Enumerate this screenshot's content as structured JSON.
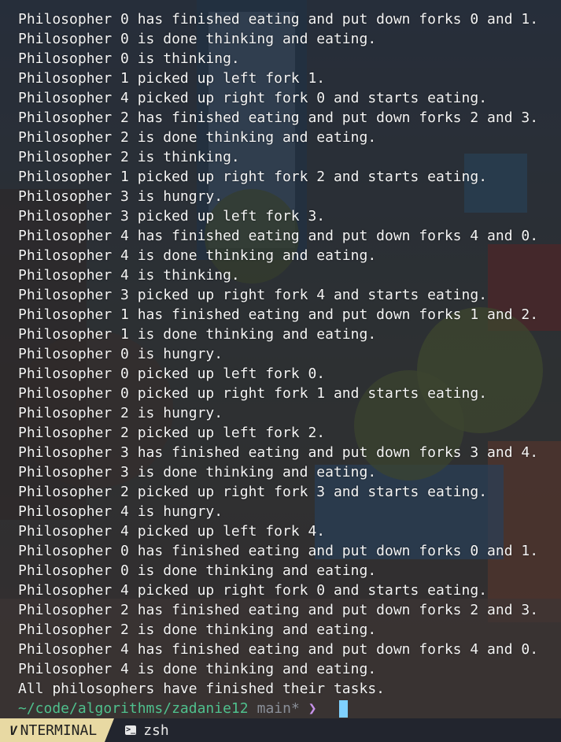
{
  "terminal": {
    "lines": [
      "Philosopher 0 has finished eating and put down forks 0 and 1.",
      "Philosopher 0 is done thinking and eating.",
      "Philosopher 0 is thinking.",
      "Philosopher 1 picked up left fork 1.",
      "Philosopher 4 picked up right fork 0 and starts eating.",
      "Philosopher 2 has finished eating and put down forks 2 and 3.",
      "Philosopher 2 is done thinking and eating.",
      "Philosopher 2 is thinking.",
      "Philosopher 1 picked up right fork 2 and starts eating.",
      "Philosopher 3 is hungry.",
      "Philosopher 3 picked up left fork 3.",
      "Philosopher 4 has finished eating and put down forks 4 and 0.",
      "Philosopher 4 is done thinking and eating.",
      "Philosopher 4 is thinking.",
      "Philosopher 3 picked up right fork 4 and starts eating.",
      "Philosopher 1 has finished eating and put down forks 1 and 2.",
      "Philosopher 1 is done thinking and eating.",
      "Philosopher 0 is hungry.",
      "Philosopher 0 picked up left fork 0.",
      "Philosopher 0 picked up right fork 1 and starts eating.",
      "Philosopher 2 is hungry.",
      "Philosopher 2 picked up left fork 2.",
      "Philosopher 3 has finished eating and put down forks 3 and 4.",
      "Philosopher 3 is done thinking and eating.",
      "Philosopher 2 picked up right fork 3 and starts eating.",
      "Philosopher 4 is hungry.",
      "Philosopher 4 picked up left fork 4.",
      "Philosopher 0 has finished eating and put down forks 0 and 1.",
      "Philosopher 0 is done thinking and eating.",
      "Philosopher 4 picked up right fork 0 and starts eating.",
      "Philosopher 2 has finished eating and put down forks 2 and 3.",
      "Philosopher 2 is done thinking and eating.",
      "Philosopher 4 has finished eating and put down forks 4 and 0.",
      "Philosopher 4 is done thinking and eating.",
      "All philosophers have finished their tasks."
    ],
    "prompt": {
      "path": "~/code/algorithms/zadanie12",
      "branch": "main*",
      "symbol": "❯"
    }
  },
  "statusbar": {
    "mode_icon": "V",
    "mode_label": "NTERMINAL",
    "tab_icon": ">_",
    "tab_label": "zsh"
  },
  "colors": {
    "text": "#f4f4f4",
    "path": "#4fc08d",
    "branch": "#8a8f98",
    "prompt_symbol": "#c792ea",
    "cursor": "#7fd1ff",
    "mode_bg": "#e8d9a3"
  }
}
